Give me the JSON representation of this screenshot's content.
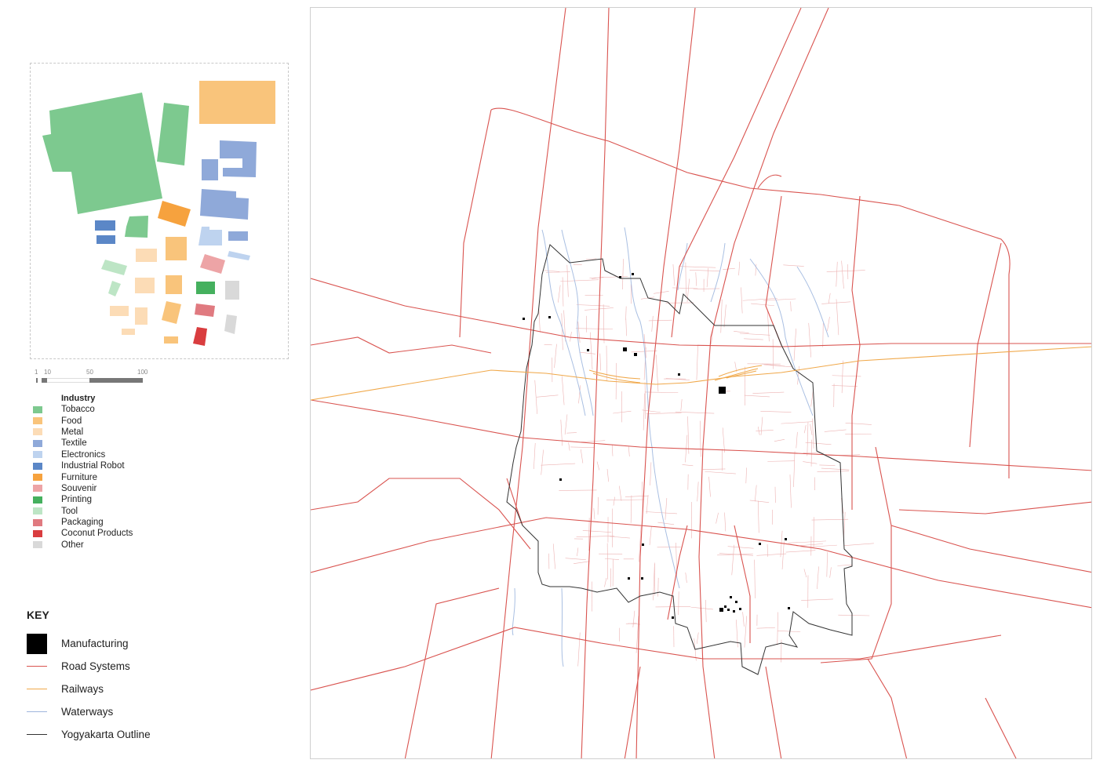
{
  "scale_bar": {
    "ticks": [
      "1",
      "10",
      "50",
      "100"
    ]
  },
  "industry_legend": {
    "title": "Industry",
    "items": [
      {
        "label": "Tobacco",
        "color": "#7dc98f"
      },
      {
        "label": "Food",
        "color": "#f9c47b"
      },
      {
        "label": "Metal",
        "color": "#fcdcb6"
      },
      {
        "label": "Textile",
        "color": "#8fa9d9"
      },
      {
        "label": "Electronics",
        "color": "#bed3ef"
      },
      {
        "label": "Industrial Robot",
        "color": "#5b87c7"
      },
      {
        "label": "Furniture",
        "color": "#f6a23e"
      },
      {
        "label": "Souvenir",
        "color": "#eda4a6"
      },
      {
        "label": "Printing",
        "color": "#45b05e"
      },
      {
        "label": "Tool",
        "color": "#bde5c5"
      },
      {
        "label": "Packaging",
        "color": "#e07a80"
      },
      {
        "label": "Coconut Products",
        "color": "#d93d3f"
      },
      {
        "label": "Other",
        "color": "#d9d9d9"
      }
    ]
  },
  "key": {
    "title": "KEY",
    "items": [
      {
        "label": "Manufacturing",
        "symbol": "square",
        "color": "#000000"
      },
      {
        "label": "Road Systems",
        "symbol": "line",
        "color": "#d9534f"
      },
      {
        "label": "Railways",
        "symbol": "line",
        "color": "#f0a84a"
      },
      {
        "label": "Waterways",
        "symbol": "line",
        "color": "#9fb6dd"
      },
      {
        "label": "Yogyakarta Outline",
        "symbol": "line",
        "color": "#333333"
      }
    ]
  },
  "map": {
    "road_color": "#d9534f",
    "railway_color": "#f0a84a",
    "waterway_color": "#9fb6dd",
    "outline_color": "#333333",
    "manufacturing_color": "#000000"
  }
}
